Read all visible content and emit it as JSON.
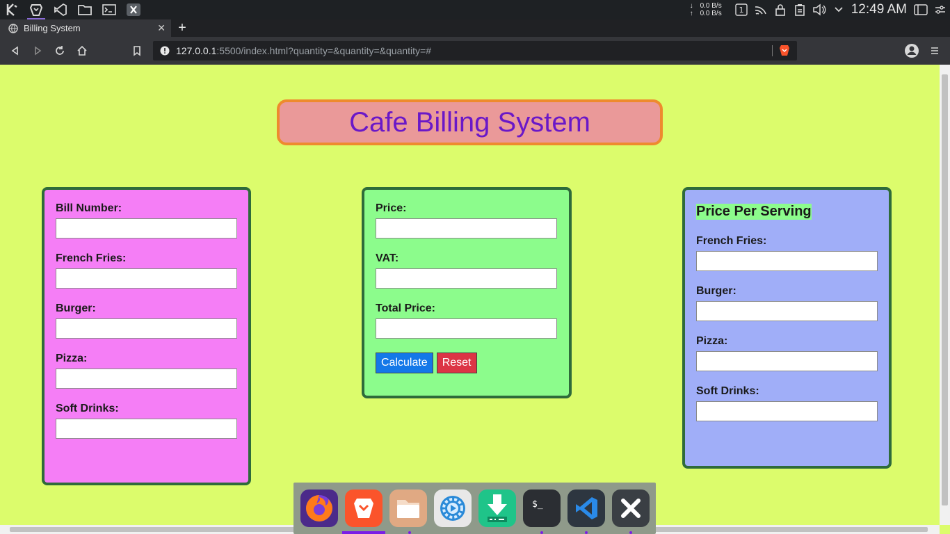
{
  "system_panel": {
    "apps": [
      {
        "name": "kde-menu-icon"
      },
      {
        "name": "brave-browser-icon"
      },
      {
        "name": "vscode-icon"
      },
      {
        "name": "file-manager-icon"
      },
      {
        "name": "terminal-icon"
      },
      {
        "name": "close-app-icon"
      }
    ],
    "net_down": "0.0 B/s",
    "net_up": "0.0 B/s",
    "desktop_number": "1",
    "clock": "12:49 AM"
  },
  "browser": {
    "tab_title": "Billing System",
    "url_host": "127.0.0.1",
    "url_rest": ":5500/index.html?quantity=&quantity=&quantity=#"
  },
  "page": {
    "title": "Cafe Billing System",
    "left_card": {
      "fields": [
        {
          "label": "Bill Number:",
          "value": ""
        },
        {
          "label": "French Fries:",
          "value": ""
        },
        {
          "label": "Burger:",
          "value": ""
        },
        {
          "label": "Pizza:",
          "value": ""
        },
        {
          "label": "Soft Drinks:",
          "value": ""
        }
      ]
    },
    "middle_card": {
      "fields": [
        {
          "label": "Price:",
          "value": ""
        },
        {
          "label": "VAT:",
          "value": ""
        },
        {
          "label": "Total Price:",
          "value": ""
        }
      ],
      "calculate_label": "Calculate",
      "reset_label": "Reset"
    },
    "right_card": {
      "heading": "Price Per Serving",
      "fields": [
        {
          "label": "French Fries:",
          "value": ""
        },
        {
          "label": "Burger:",
          "value": ""
        },
        {
          "label": "Pizza:",
          "value": ""
        },
        {
          "label": "Soft Drinks:",
          "value": ""
        }
      ]
    }
  },
  "dock": {
    "items": [
      {
        "name": "firefox-icon",
        "color": "#e66000"
      },
      {
        "name": "brave-icon",
        "color": "#fb542b"
      },
      {
        "name": "files-icon",
        "color": "#e0a983"
      },
      {
        "name": "settings-icon",
        "color": "#2a8ad8"
      },
      {
        "name": "downloader-icon",
        "color": "#1fc489"
      },
      {
        "name": "terminal-icon",
        "color": "#2b2e33"
      },
      {
        "name": "vscode-icon",
        "color": "#2d3640"
      },
      {
        "name": "close-icon",
        "color": "#3a3f44"
      }
    ]
  },
  "colors": {
    "page_background": "#dcfc6c",
    "title_box": "#ea9999",
    "title_border": "#ee8a2e",
    "title_text": "#6a18c8",
    "left_card": "#f57ef6",
    "middle_card": "#8cfc8c",
    "right_card": "#a0aef8",
    "card_border": "#2e6b3a",
    "calculate_button": "#1478e8",
    "reset_button": "#dc3545"
  }
}
